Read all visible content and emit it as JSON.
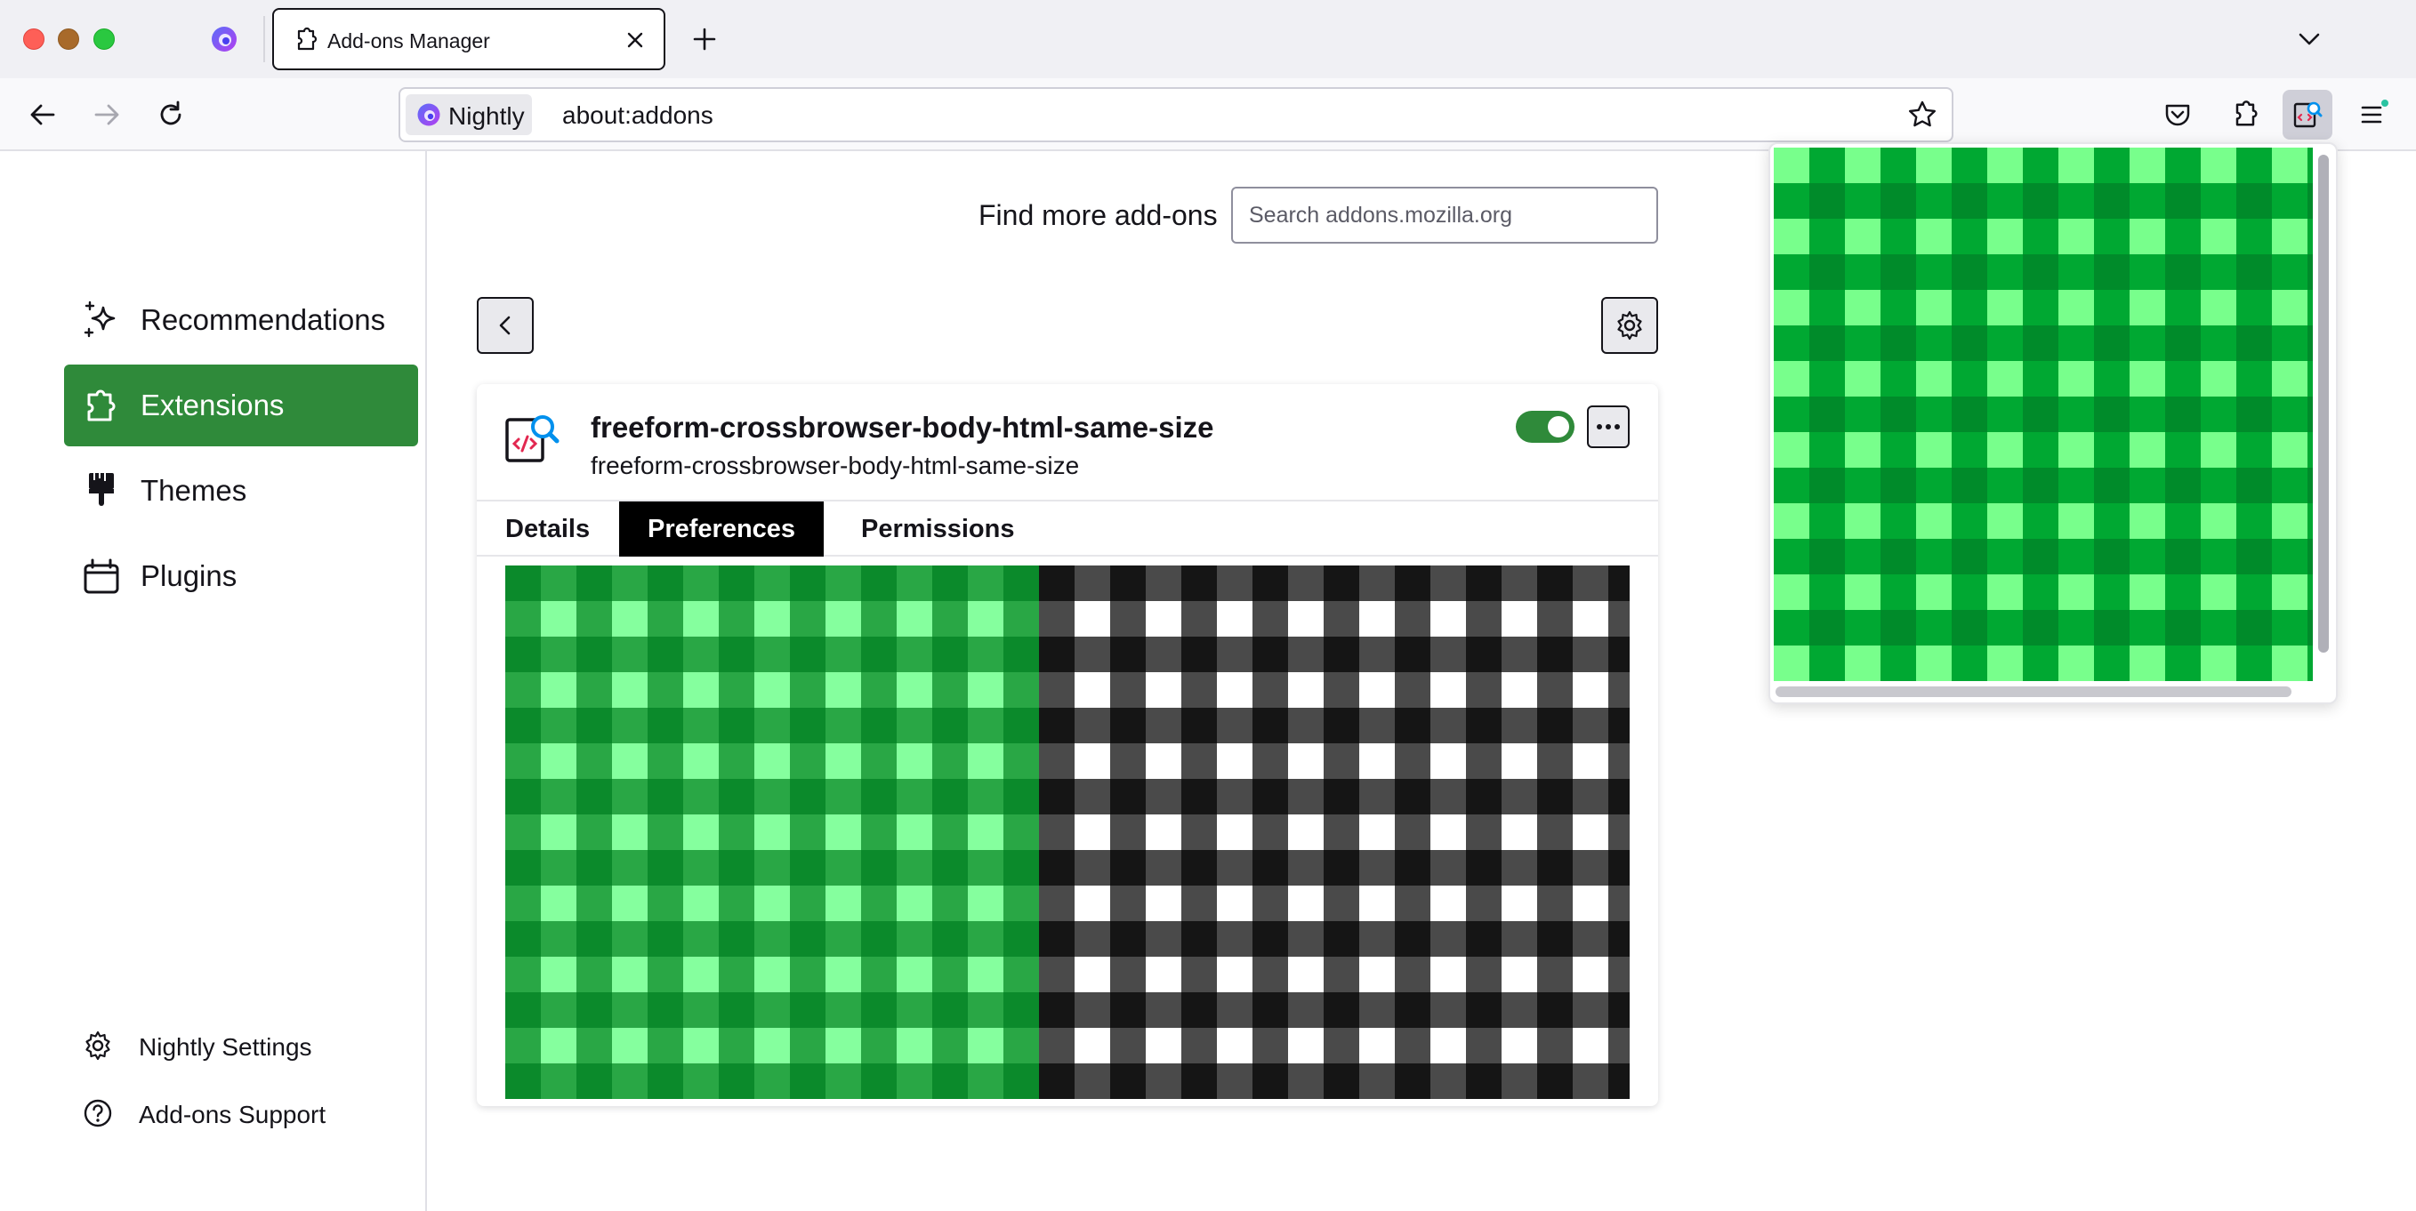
{
  "window": {
    "tab_title": "Add-ons Manager",
    "identity_label": "Nightly",
    "url": "about:addons"
  },
  "sidebar": {
    "categories": [
      {
        "label": "Recommendations",
        "icon": "sparkle-icon",
        "selected": false
      },
      {
        "label": "Extensions",
        "icon": "puzzle-icon",
        "selected": true
      },
      {
        "label": "Themes",
        "icon": "paintbrush-icon",
        "selected": false
      },
      {
        "label": "Plugins",
        "icon": "plugin-icon",
        "selected": false
      }
    ],
    "footer": [
      {
        "label": "Nightly Settings",
        "icon": "gear-icon"
      },
      {
        "label": "Add-ons Support",
        "icon": "help-icon"
      }
    ]
  },
  "main": {
    "find_more_label": "Find more add-ons",
    "search_placeholder": "Search addons.mozilla.org",
    "addon": {
      "name": "freeform-crossbrowser-body-html-same-size",
      "description": "freeform-crossbrowser-body-html-same-size",
      "enabled": true,
      "tabs": [
        {
          "label": "Details",
          "selected": false
        },
        {
          "label": "Preferences",
          "selected": true
        },
        {
          "label": "Permissions",
          "selected": false
        }
      ]
    }
  },
  "colors": {
    "accent": "#2f8a3a",
    "green_checker": [
      "#0b8a2b",
      "#29a745",
      "#85ff9e"
    ],
    "gray_checker": [
      "#151515",
      "#4a4a4a",
      "#ffffff"
    ],
    "popup_checker": [
      "#008b2a",
      "#00a832",
      "#78ff8c"
    ]
  }
}
